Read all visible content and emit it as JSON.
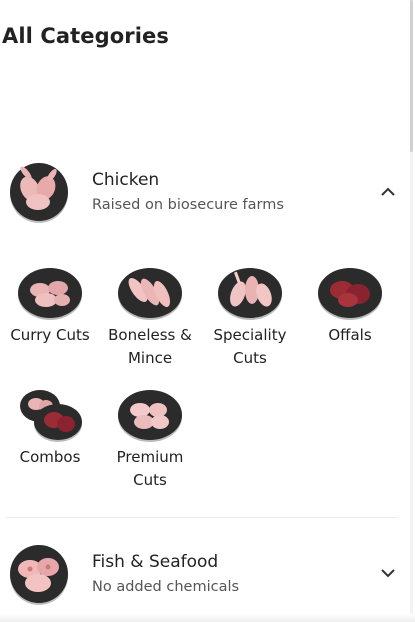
{
  "page": {
    "title": "All Categories"
  },
  "categories": [
    {
      "name": "Chicken",
      "subtitle": "Raised on biosecure farms",
      "expanded": true,
      "icon": "chicken-plate-icon",
      "items": [
        {
          "label": "Curry Cuts",
          "icon": "curry-cuts-icon"
        },
        {
          "label": "Boneless & Mince",
          "icon": "boneless-mince-icon"
        },
        {
          "label": "Speciality Cuts",
          "icon": "speciality-cuts-icon"
        },
        {
          "label": "Offals",
          "icon": "offals-icon"
        },
        {
          "label": "Combos",
          "icon": "combos-icon"
        },
        {
          "label": "Premium Cuts",
          "icon": "premium-cuts-icon"
        }
      ]
    },
    {
      "name": "Fish & Seafood",
      "subtitle": "No added chemicals",
      "expanded": false,
      "icon": "fish-plate-icon"
    }
  ],
  "colors": {
    "plate": "#2b2b2b",
    "chicken_meat": "#e9b4b4",
    "offal_meat": "#9b2c34",
    "text_primary": "#222222",
    "text_secondary": "#555555"
  }
}
